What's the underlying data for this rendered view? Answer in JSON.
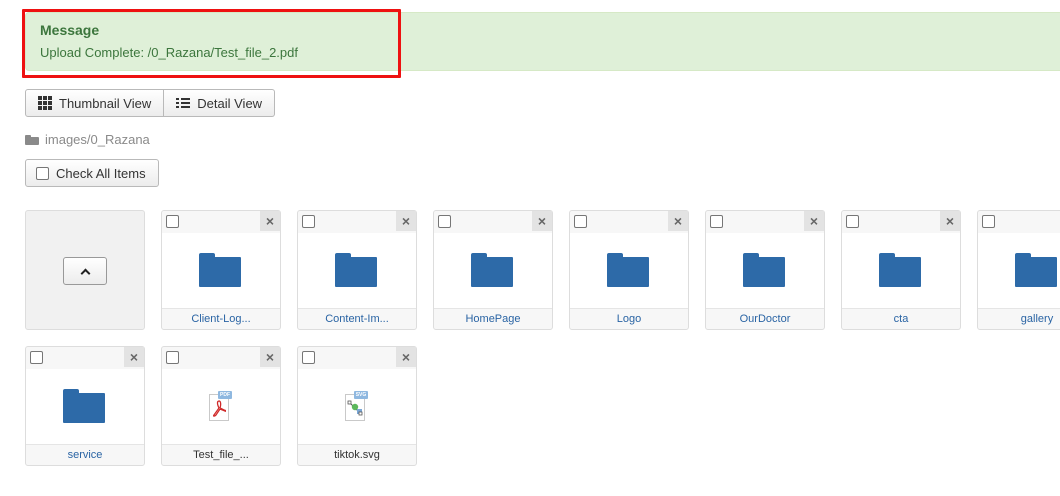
{
  "message": {
    "title": "Message",
    "text": "Upload Complete: /0_Razana/Test_file_2.pdf"
  },
  "toolbar": {
    "thumbnail_view": "Thumbnail View",
    "detail_view": "Detail View"
  },
  "breadcrumb": {
    "path": "images/0_Razana"
  },
  "check_all": {
    "label": "Check All Items"
  },
  "items": [
    {
      "type": "folder",
      "label": "Client-Log..."
    },
    {
      "type": "folder",
      "label": "Content-Im..."
    },
    {
      "type": "folder",
      "label": "HomePage"
    },
    {
      "type": "folder",
      "label": "Logo"
    },
    {
      "type": "folder",
      "label": "OurDoctor"
    },
    {
      "type": "folder",
      "label": "cta"
    },
    {
      "type": "folder",
      "label": "gallery"
    },
    {
      "type": "folder",
      "label": "service"
    },
    {
      "type": "pdf",
      "label": "Test_file_...",
      "badge": "PDF"
    },
    {
      "type": "svg",
      "label": "tiktok.svg",
      "badge": "SVG"
    }
  ],
  "colors": {
    "alert_bg": "#dff0d8",
    "alert_text": "#3c763d",
    "highlight": "#e11111",
    "folder": "#2d6aa8",
    "link": "#2a64a4"
  },
  "icons": {
    "delete": "×",
    "up": "chevron-up"
  }
}
